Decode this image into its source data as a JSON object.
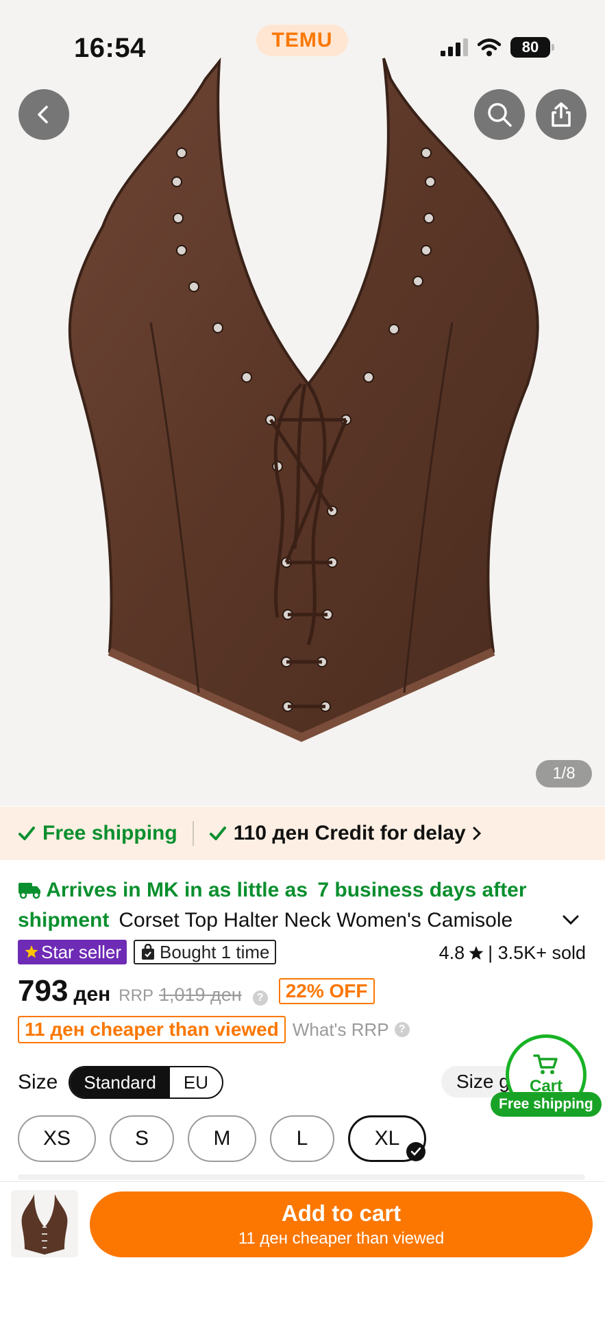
{
  "status_bar": {
    "time": "16:54",
    "battery": "80"
  },
  "brand": {
    "name": "TEMU"
  },
  "gallery": {
    "counter": "1/8"
  },
  "shipping_band": {
    "free_shipping": "Free shipping",
    "credit": "110 ден Credit for delay"
  },
  "delivery": {
    "part1": "Arrives in MK in as little as",
    "part2": "7 business days after",
    "part3": "shipment",
    "title": "Corset Top Halter Neck Women's Camisole"
  },
  "badges": {
    "star_seller": "Star seller",
    "bought": "Bought 1 time"
  },
  "rating": {
    "score": "4.8",
    "sold": "| 3.5K+ sold"
  },
  "price": {
    "value": "793",
    "currency": "ден",
    "rrp_label": "RRP",
    "rrp_value": "1,019 ден",
    "discount": "22% OFF",
    "cheaper_badge": "11 ден cheaper than viewed",
    "whats_rrp": "What's RRP"
  },
  "size": {
    "label": "Size",
    "tabs": [
      "Standard",
      "EU"
    ],
    "guide": "Size guide",
    "options": [
      "XS",
      "S",
      "M",
      "L",
      "XL"
    ],
    "selected": "XL"
  },
  "cart_float": {
    "label": "Cart",
    "free_shipping": "Free shipping"
  },
  "bottom": {
    "add_to_cart": "Add to cart",
    "sub": "11 ден cheaper than viewed"
  },
  "colors": {
    "accent": "#fb7701",
    "green": "#0a8f2e",
    "star_seller": "#6e2bb5"
  }
}
